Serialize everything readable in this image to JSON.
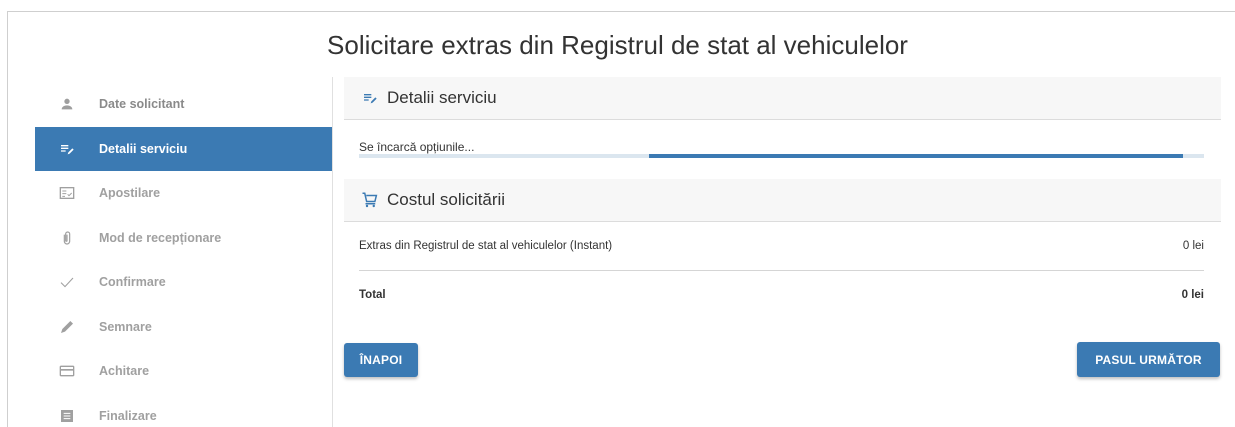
{
  "page": {
    "title": "Solicitare extras din Registrul de stat al vehiculelor"
  },
  "sidebar": {
    "items": [
      {
        "label": "Date solicitant",
        "icon": "person-icon",
        "active": false
      },
      {
        "label": "Detalii serviciu",
        "icon": "edit-list-icon",
        "active": true
      },
      {
        "label": "Apostilare",
        "icon": "document-check-icon",
        "active": false
      },
      {
        "label": "Mod de recepționare",
        "icon": "paperclip-icon",
        "active": false
      },
      {
        "label": "Confirmare",
        "icon": "check-icon",
        "active": false
      },
      {
        "label": "Semnare",
        "icon": "pen-icon",
        "active": false
      },
      {
        "label": "Achitare",
        "icon": "credit-card-icon",
        "active": false
      },
      {
        "label": "Finalizare",
        "icon": "list-document-icon",
        "active": false
      }
    ]
  },
  "service_section": {
    "title": "Detalii serviciu",
    "icon": "edit-list-icon",
    "loading_text": "Se încarcă opțiunile..."
  },
  "cost_section": {
    "title": "Costul solicitării",
    "icon": "cart-icon",
    "rows": [
      {
        "label": "Extras din Registrul de stat al vehiculelor (Instant)",
        "value": "0 lei"
      }
    ],
    "total": {
      "label": "Total",
      "value": "0 lei"
    }
  },
  "buttons": {
    "back": "ÎNAPOI",
    "next": "PASUL URMĂTOR"
  },
  "colors": {
    "accent": "#3b7ab3"
  }
}
